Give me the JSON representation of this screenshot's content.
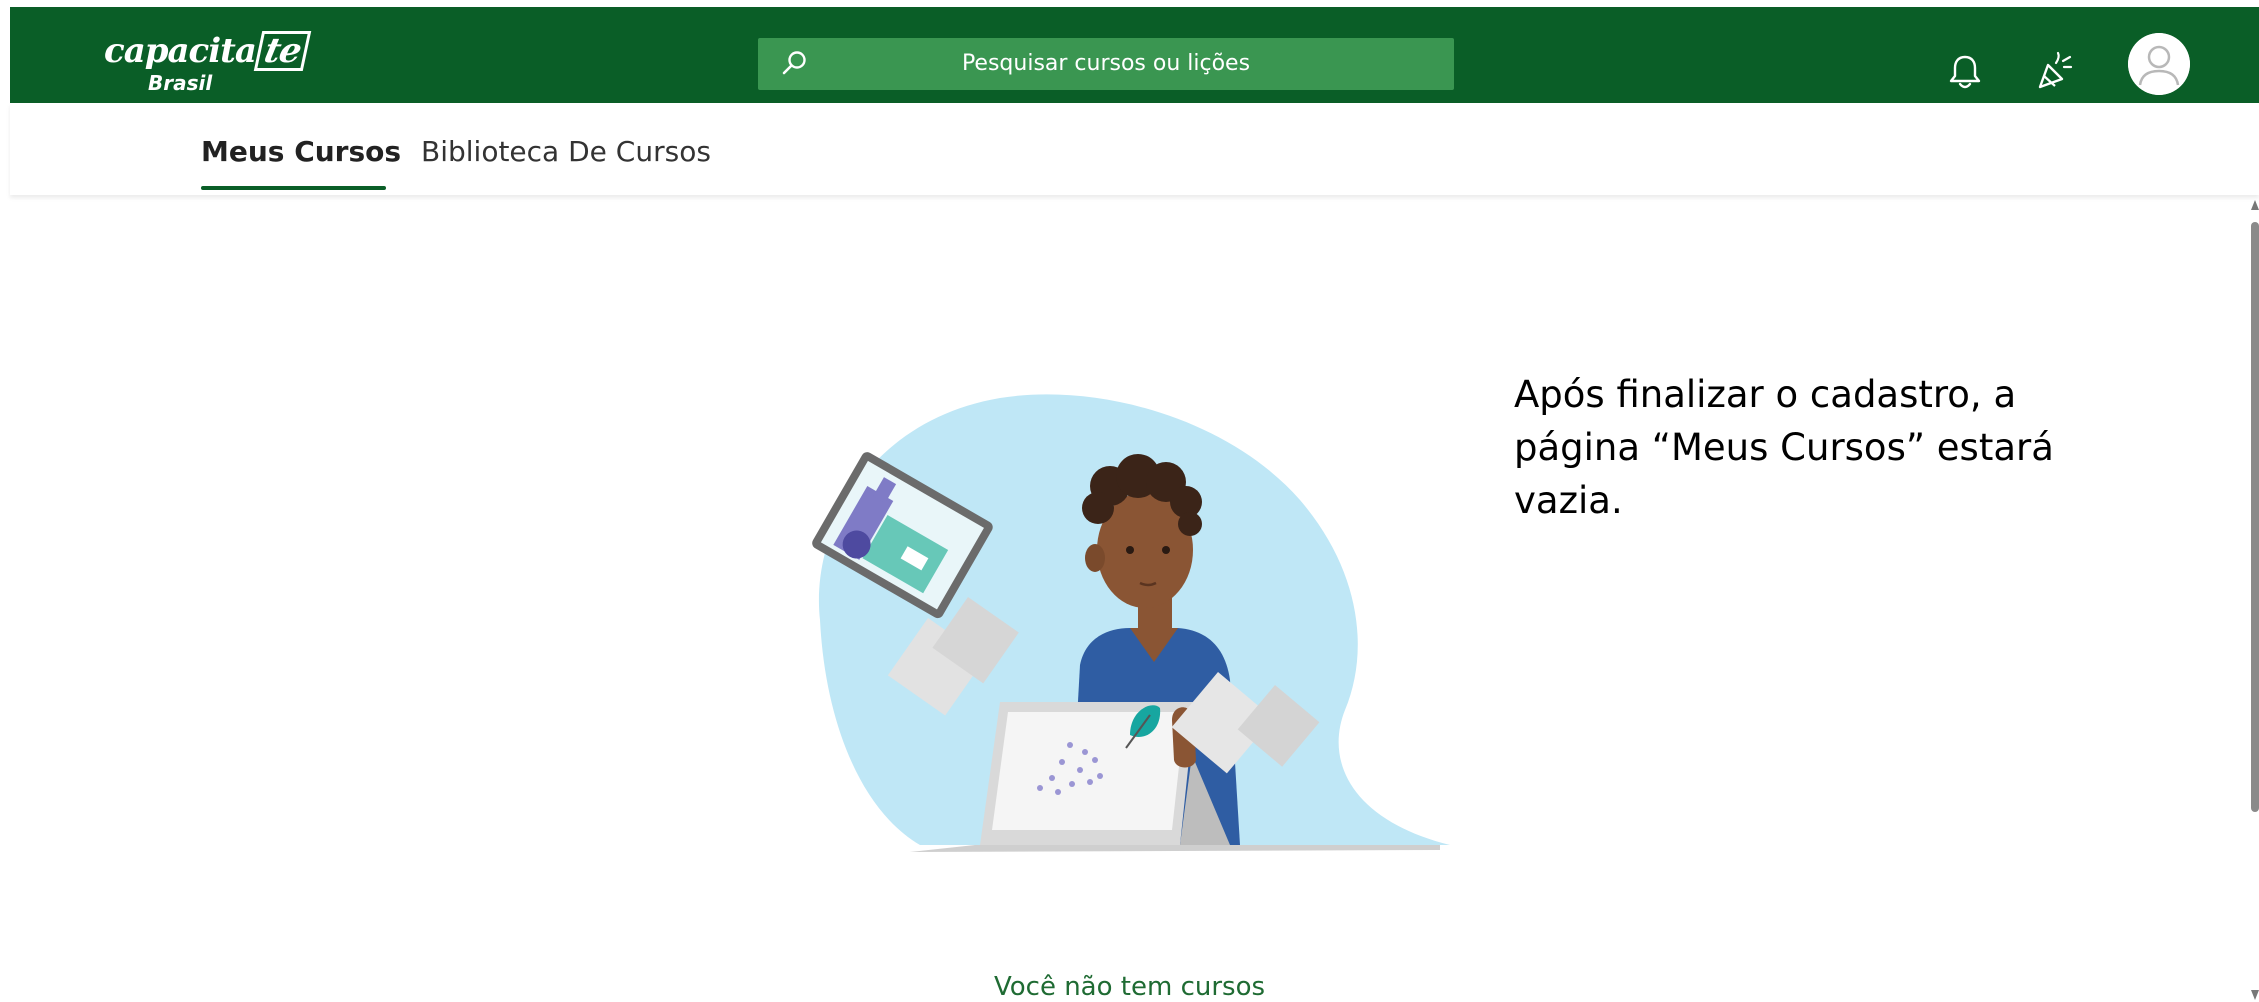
{
  "colors": {
    "brand": "#0a5e27",
    "search_bg": "#3a9651",
    "empty_text": "#1f6b33"
  },
  "header": {
    "logo_main": "capacita",
    "logo_box": "te",
    "logo_sub": "Brasil",
    "search_placeholder": "Pesquisar cursos ou lições",
    "icons": [
      "search-icon",
      "bell-icon",
      "celebrate-icon",
      "avatar-icon"
    ]
  },
  "tabs": [
    {
      "label": "Meus Cursos",
      "active": true
    },
    {
      "label": "Biblioteca De Cursos",
      "active": false
    }
  ],
  "main": {
    "annotation": "Após finalizar o cadastro, a página “Meus Cursos” estará vazia.",
    "empty_message": "Você não tem cursos"
  }
}
